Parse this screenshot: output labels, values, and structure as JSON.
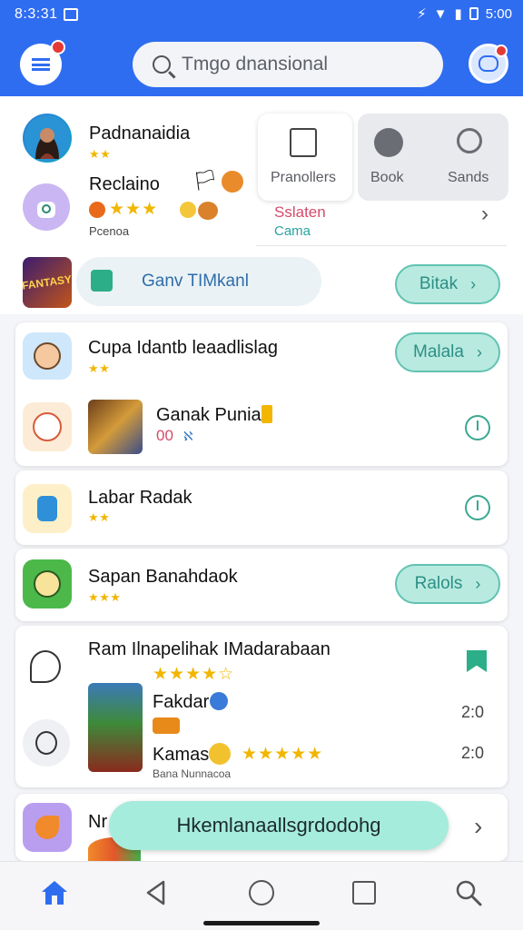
{
  "status_bar": {
    "time": "8:3:31",
    "battery": "5:00"
  },
  "header": {
    "search_placeholder": "Tmgo dnansional"
  },
  "top_list": [
    {
      "title": "Padnanaidia",
      "stars": "★★"
    },
    {
      "title": "Reclaino",
      "stars": "★★★",
      "subtitle": "Pcenoa"
    }
  ],
  "tabs": [
    {
      "label": "Pranollers"
    },
    {
      "label": "Book"
    },
    {
      "label": "Sands"
    }
  ],
  "category_info": {
    "line1": "Sslaten",
    "line2": "Cama"
  },
  "banner": {
    "pill_label": "Ganv TIMkanl",
    "button_label": "Bitak"
  },
  "card1": {
    "title": "Cupa Idantb leaadlislag",
    "stars": "★★",
    "button_label": "Malala",
    "subitem": {
      "title": "Ganak Punia",
      "meta": "00",
      "meta2": "ℵ"
    }
  },
  "card2": {
    "title": "Labar Radak",
    "stars": "★★"
  },
  "card3": {
    "title": "Sapan Banahdaok",
    "stars": "★★★",
    "button_label": "Ralols"
  },
  "card4": {
    "title": "Ram Ilnapelihak IMadarabaan",
    "stars": "★★★★☆",
    "item1": {
      "title": "Fakdar",
      "value": "2:0"
    },
    "item2": {
      "title": "Kamas",
      "stars": "★★★★★",
      "value": "2:0",
      "subtitle": "Bana Nunnacoa"
    }
  },
  "card5": {
    "title": "Nr"
  },
  "floating_button": {
    "label": "Hkemlanaallsgrdodohg"
  },
  "colors": {
    "header": "#2f6df0",
    "accent_teal": "#62c3b2",
    "star": "#f2b600"
  }
}
